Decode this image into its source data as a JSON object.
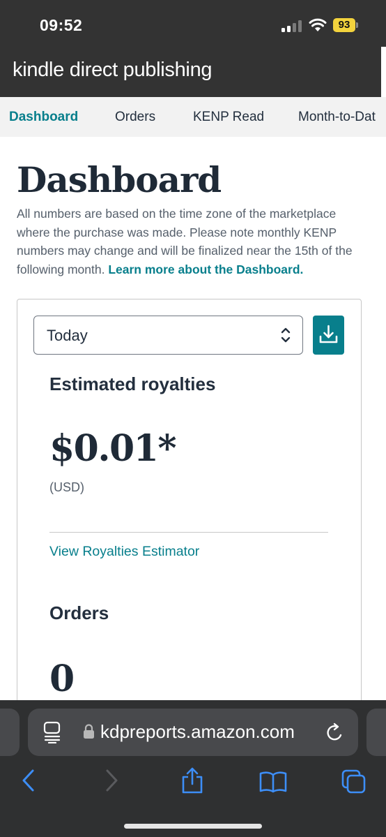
{
  "status_bar": {
    "time": "09:52",
    "battery": "93",
    "battery_color": "#f3d33d"
  },
  "header": {
    "brand_bold": "kindle",
    "brand_rest": "direct publishing"
  },
  "tabs": [
    {
      "label": "Dashboard",
      "active": true
    },
    {
      "label": "Orders",
      "active": false
    },
    {
      "label": "KENP Read",
      "active": false
    },
    {
      "label": "Month-to-Dat",
      "active": false
    }
  ],
  "main": {
    "title": "Dashboard",
    "intro_text": "All numbers are based on the time zone of the marketplace where the purchase was made. Please note monthly KENP numbers may change and will be finalized near the 15th of the following month.",
    "intro_link": "Learn more about the Dashboard."
  },
  "card": {
    "period_select": {
      "value": "Today",
      "icon": "chevron-up-down-icon"
    },
    "download_icon": "download-icon",
    "royalties": {
      "heading": "Estimated royalties",
      "amount": "$0.01*",
      "currency": "(USD)",
      "estimator_link": "View Royalties Estimator"
    },
    "orders": {
      "heading": "Orders",
      "count": "0"
    }
  },
  "browser": {
    "url": "kdpreports.amazon.com",
    "icons": [
      "reader-icon",
      "lock-icon",
      "reload-icon",
      "back-icon",
      "forward-icon",
      "share-icon",
      "bookmarks-icon",
      "tabs-icon"
    ]
  },
  "colors": {
    "accent": "#087f8c",
    "header_bg": "#333333",
    "ios_blue": "#3d8ef7"
  }
}
